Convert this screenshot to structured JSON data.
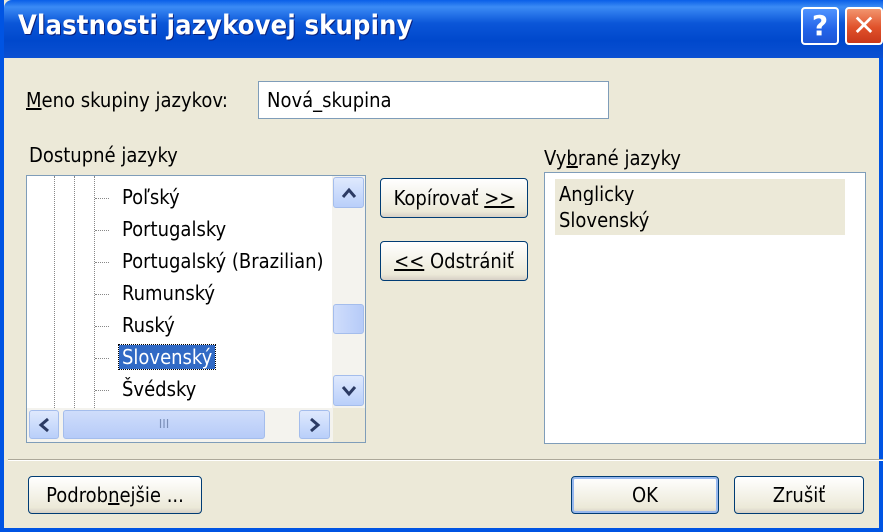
{
  "window": {
    "title": "Vlastnosti jazykovej skupiny"
  },
  "titlebar": {
    "help": "?",
    "close": "✕"
  },
  "name_field": {
    "label_underlined": "M",
    "label_rest": "eno skupiny jazykov:",
    "value": "Nová_skupina"
  },
  "available": {
    "label_pre": "Dostupné ",
    "label_underlined": "j",
    "label_post": "azyky",
    "items": [
      "Poľský",
      "Portugalsky",
      "Portugalský (Brazilian)",
      "Rumunský",
      "Ruský",
      "Slovenský",
      "Švédsky"
    ],
    "selected_index": 5,
    "hscroll_grip": "III"
  },
  "selected": {
    "label_pre": "Vy",
    "label_underlined": "b",
    "label_post": "rané jazyky",
    "items": [
      "Anglicky",
      "Slovenský"
    ]
  },
  "buttons": {
    "copy_pre": "Kopírovať ",
    "copy_underlined": ">>",
    "remove_underlined": "<<",
    "remove_post": " Odstrániť",
    "details_pre": "Podrob",
    "details_underlined": "n",
    "details_post": "ejšie ...",
    "ok": "OK",
    "cancel": "Zrušiť"
  }
}
